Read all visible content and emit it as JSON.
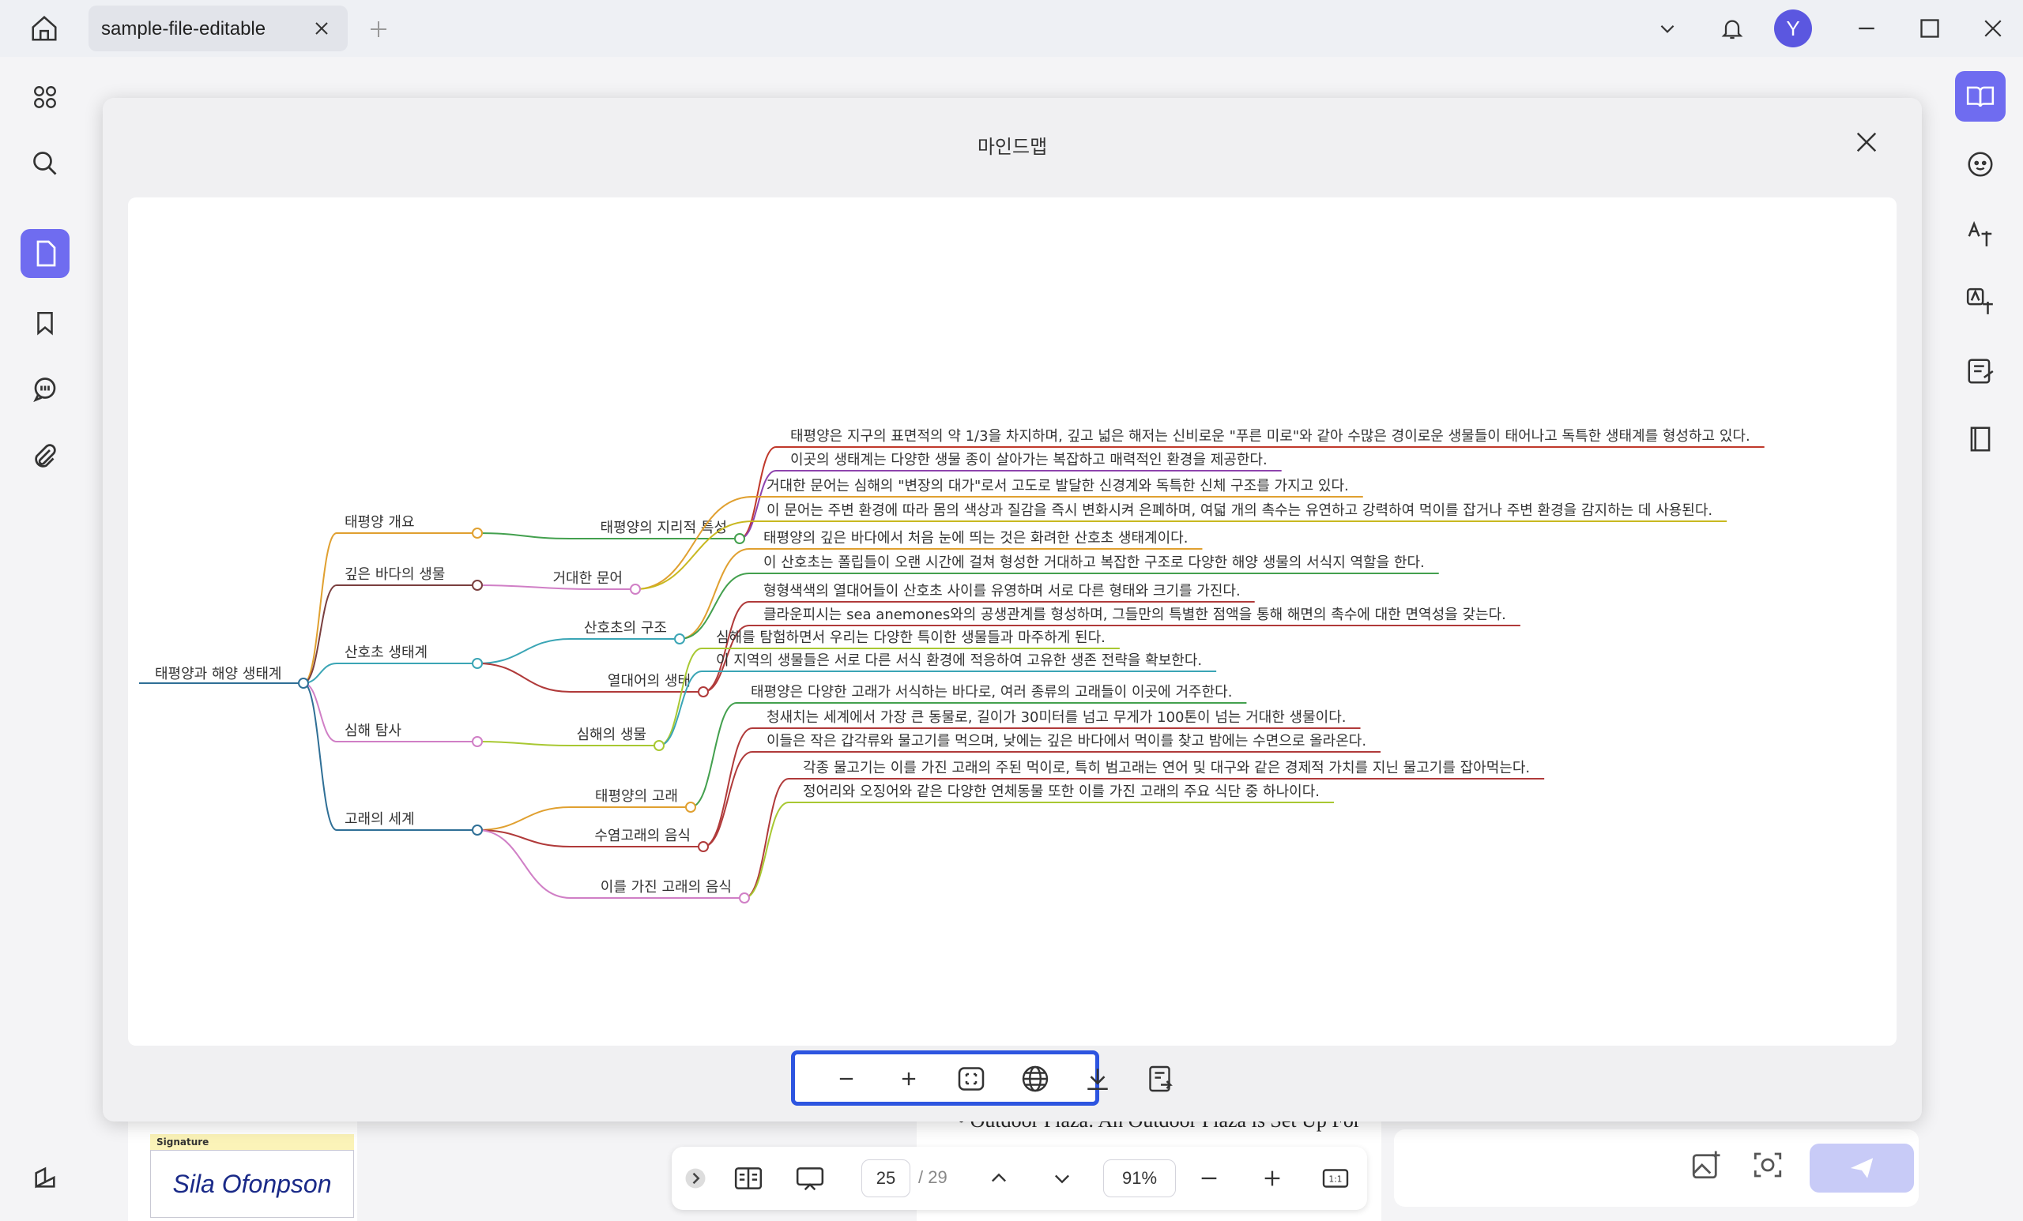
{
  "titlebar": {
    "tab_title": "sample-file-editable",
    "avatar_letter": "Y"
  },
  "modal": {
    "title": "마인드맵"
  },
  "mindmap": {
    "root": "태평양과 해양 생태계",
    "branches": [
      {
        "label": "태평양 개요",
        "children": [
          {
            "label": "태평양의 지리적 특성",
            "leaves": [
              "태평양은 지구의 표면적의 약 1/3을 차지하며, 깊고 넓은 해저는 신비로운 \"푸른 미로\"와 같아 수많은 경이로운 생물들이 태어나고 독특한 생태계를 형성하고 있다.",
              "이곳의 생태계는 다양한 생물 종이 살아가는 복잡하고 매력적인 환경을 제공한다."
            ]
          }
        ]
      },
      {
        "label": "깊은 바다의 생물",
        "children": [
          {
            "label": "거대한 문어",
            "leaves": [
              "거대한 문어는 심해의 \"변장의 대가\"로서 고도로 발달한 신경계와 독특한 신체 구조를 가지고 있다.",
              "이 문어는 주변 환경에 따라 몸의 색상과 질감을 즉시 변화시켜 은폐하며, 여덟 개의 촉수는 유연하고 강력하여 먹이를 잡거나 주변 환경을 감지하는 데 사용된다."
            ]
          }
        ]
      },
      {
        "label": "산호초 생태계",
        "children": [
          {
            "label": "산호초의 구조",
            "leaves": [
              "태평양의 깊은 바다에서 처음 눈에 띄는 것은 화려한 산호초 생태계이다.",
              "이 산호초는 폴립들이 오랜 시간에 걸쳐 형성한 거대하고 복잡한 구조로 다양한 해양 생물의 서식지 역할을 한다."
            ]
          },
          {
            "label": "열대어의 생태",
            "leaves": [
              "형형색색의 열대어들이 산호초 사이를 유영하며 서로 다른 형태와 크기를 가진다.",
              "클라운피시는 sea anemones와의 공생관계를 형성하며, 그들만의 특별한 점액을 통해 해면의 촉수에 대한 면역성을 갖는다."
            ]
          }
        ]
      },
      {
        "label": "심해 탐사",
        "children": [
          {
            "label": "심해의 생물",
            "leaves": [
              "심해를 탐험하면서 우리는 다양한 특이한 생물들과 마주하게 된다.",
              "이 지역의 생물들은 서로 다른 서식 환경에 적응하여 고유한 생존 전략을 확보한다."
            ]
          }
        ]
      },
      {
        "label": "고래의 세계",
        "children": [
          {
            "label": "태평양의 고래",
            "leaves": [
              "태평양은 다양한 고래가 서식하는 바다로, 여러 종류의 고래들이 이곳에 거주한다."
            ]
          },
          {
            "label": "수염고래의 음식",
            "leaves": [
              "청새치는 세계에서 가장 큰 동물로, 길이가 30미터를 넘고 무게가 100톤이 넘는 거대한 생물이다.",
              "이들은 작은 갑각류와 물고기를 먹으며, 낮에는 깊은 바다에서 먹이를 찾고 밤에는 수면으로 올라온다."
            ]
          },
          {
            "label": "이를 가진 고래의 음식",
            "leaves": [
              "각종 물고기는 이를 가진 고래의 주된 먹이로, 특히 범고래는 연어 및 대구와 같은 경제적 가치를 지닌 물고기를 잡아먹는다.",
              "정어리와 오징어와 같은 다양한 연체동물 또한 이를 가진 고래의 주요 식단 중 하나이다."
            ]
          }
        ]
      }
    ]
  },
  "colors": {
    "accent": "#6f6cf0",
    "toolbar_border": "#2d55e0",
    "branch_colors": [
      "#e0a030",
      "#7a3f3f",
      "#3aa5b5",
      "#d07fc6",
      "#2f6f96"
    ],
    "child_colors": [
      "#43a04e",
      "#d07fc6",
      "#3aa5b5",
      "#b03a3a",
      "#a8c832",
      "#e0a030",
      "#b03a3a",
      "#d07fc6"
    ],
    "leaf_colors": [
      "#c0392b",
      "#8e44ad",
      "#e0a030",
      "#c8b820",
      "#e0a030",
      "#43a04e",
      "#b03a3a",
      "#b03a3a",
      "#a8c832",
      "#3aa5b5",
      "#43a04e",
      "#b03a3a",
      "#b03a3a",
      "#b03a3a",
      "#a8c832"
    ]
  },
  "bottombar": {
    "page_current": "25",
    "page_total": "/ 29",
    "zoom": "91%"
  },
  "background": {
    "signature_label": "Signature",
    "signature_name": "Sila Ofonpson",
    "doc_line": "• Outdoor Plaza: An Outdoor Plaza is Set Up For"
  },
  "icons": {
    "modal_toolbar": [
      "zoom-out-icon",
      "zoom-in-icon",
      "fit-screen-icon",
      "globe-icon",
      "download-icon",
      "convert-icon"
    ]
  }
}
